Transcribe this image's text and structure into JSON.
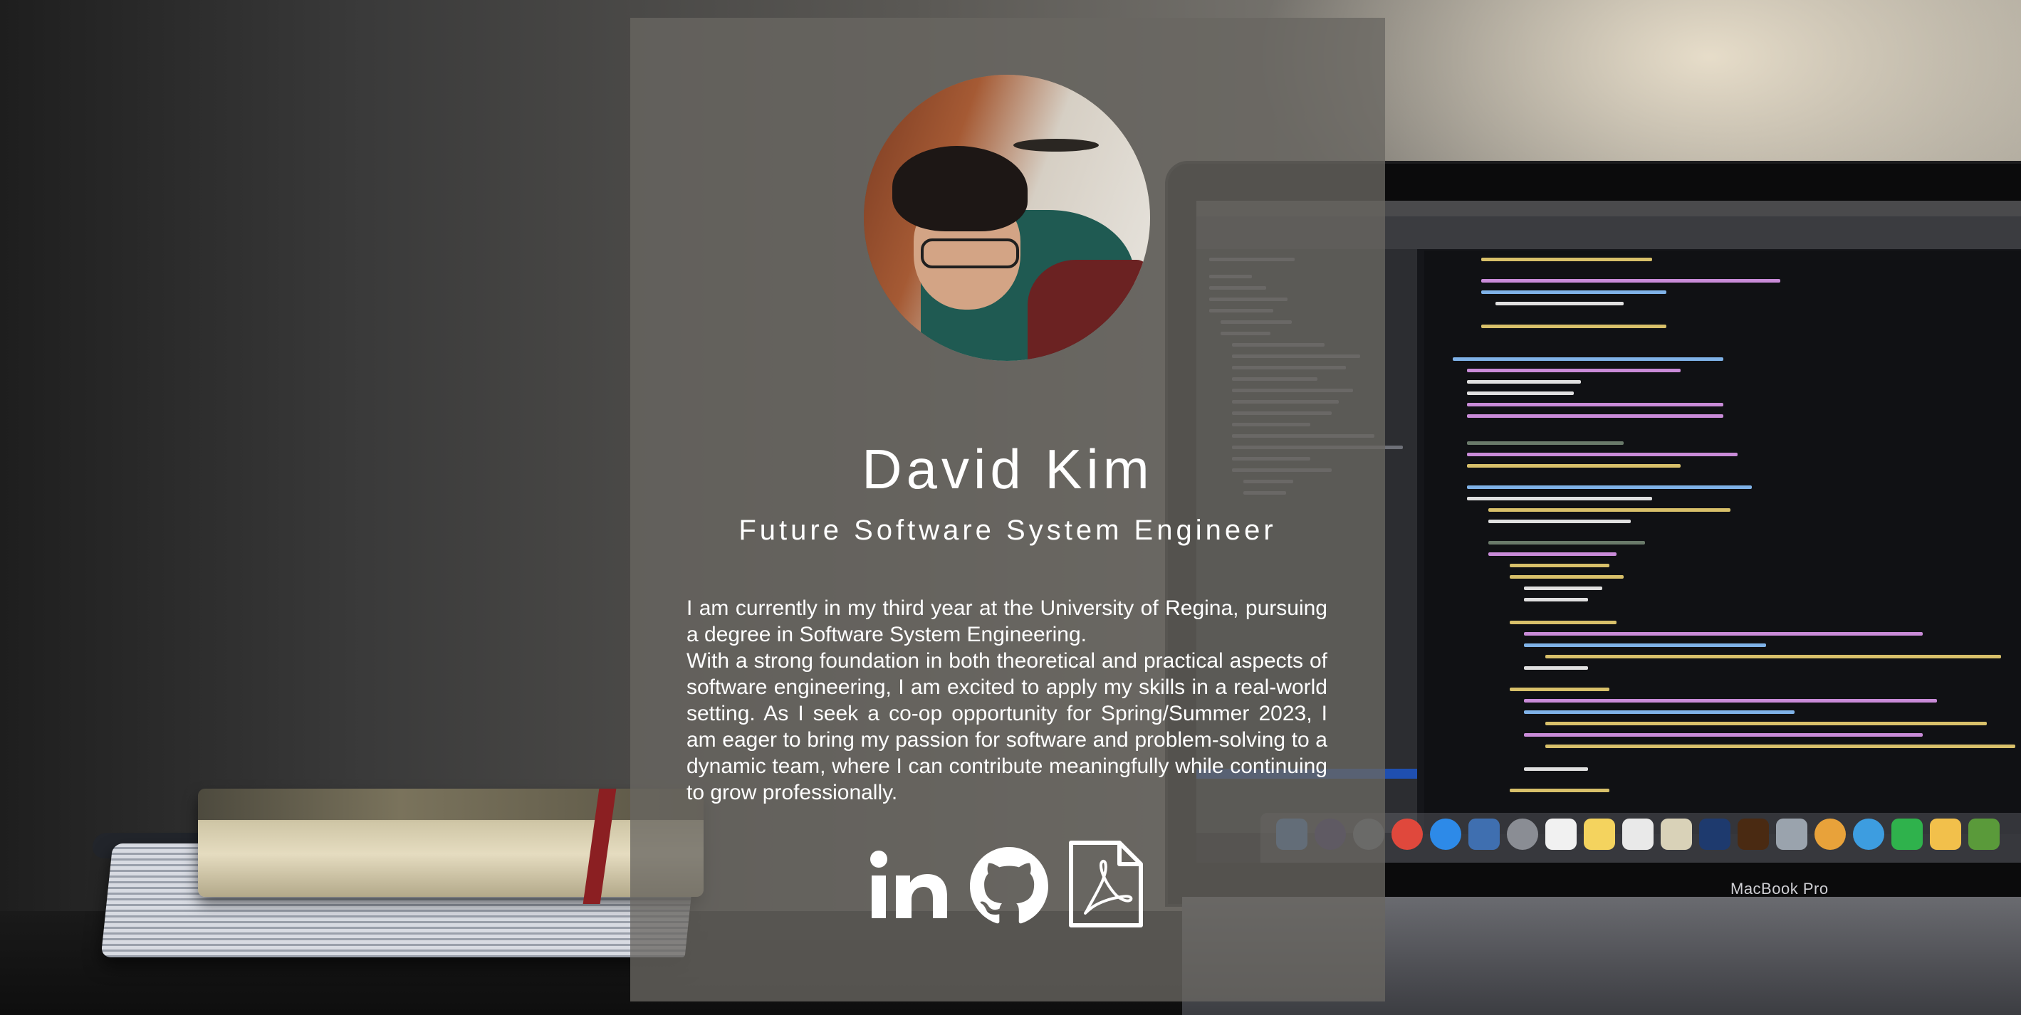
{
  "profile": {
    "name": "David Kim",
    "title": "Future Software System Engineer",
    "bio": [
      "I am currently in my third year at the University of Regina, pursuing a degree in Software System Engineering.",
      "With a strong foundation in both theoretical and practical aspects of software engineering, I am excited to apply my skills in a real-world setting. As I seek a co-op opportunity for Spring/Summer 2023, I am eager to bring my passion for software and problem-solving to a dynamic team, where I can contribute meaningfully while continuing to grow professionally."
    ]
  },
  "background": {
    "laptop_label": "MacBook Pro"
  },
  "social": [
    {
      "icon": "linkedin-icon"
    },
    {
      "icon": "github-icon"
    },
    {
      "icon": "pdf-resume-icon"
    }
  ],
  "colors": {
    "card_overlay": "#69665e",
    "text": "#ffffff"
  }
}
